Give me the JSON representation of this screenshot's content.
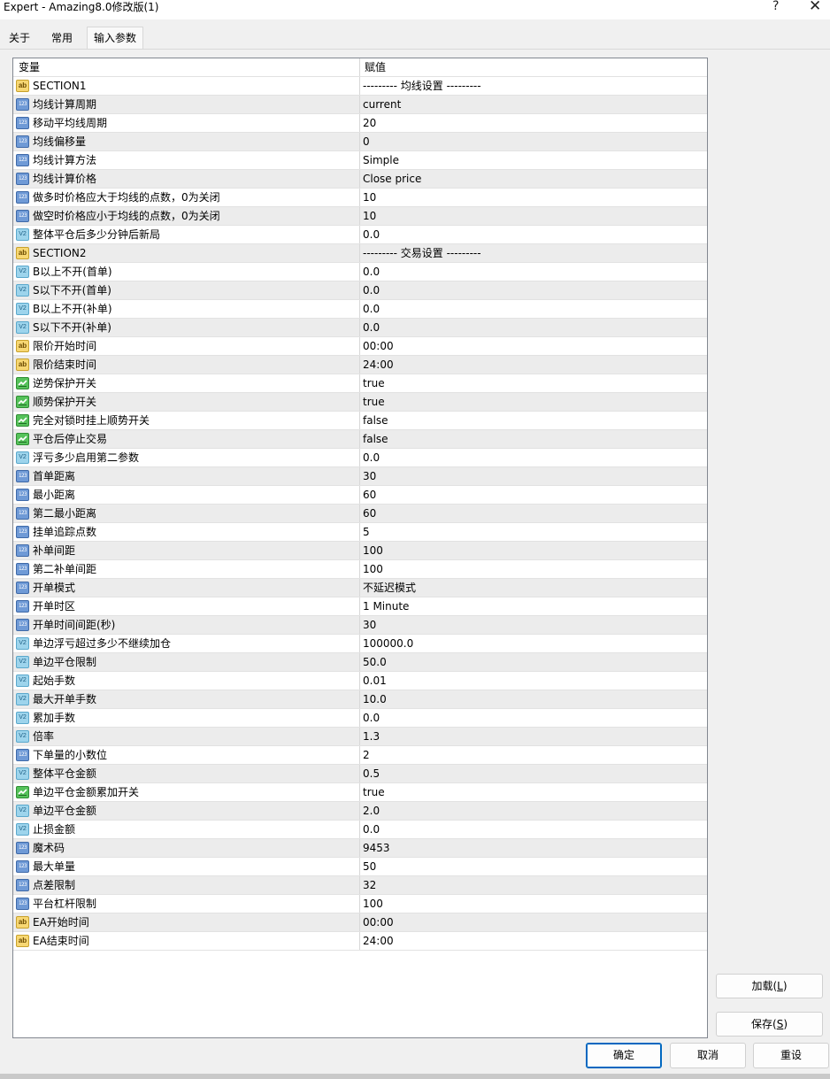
{
  "window": {
    "title": "Expert - Amazing8.0修改版(1)",
    "help_glyph": "?",
    "close_glyph": "✕"
  },
  "tabs": [
    {
      "label": "关于"
    },
    {
      "label": "常用"
    },
    {
      "label": "输入参数",
      "active": true
    }
  ],
  "grid": {
    "col_variable": "变量",
    "col_value": "赋值",
    "rows": [
      {
        "type": "string",
        "icon_text": "ab",
        "name": "SECTION1",
        "value": "--------- 均线设置 ---------"
      },
      {
        "type": "int",
        "icon_text": "123",
        "name": "均线计算周期",
        "value": "current"
      },
      {
        "type": "int",
        "icon_text": "123",
        "name": "移动平均线周期",
        "value": "20"
      },
      {
        "type": "int",
        "icon_text": "123",
        "name": "均线偏移量",
        "value": "0"
      },
      {
        "type": "int",
        "icon_text": "123",
        "name": "均线计算方法",
        "value": "Simple"
      },
      {
        "type": "int",
        "icon_text": "123",
        "name": "均线计算价格",
        "value": "Close price"
      },
      {
        "type": "int",
        "icon_text": "123",
        "name": "做多时价格应大于均线的点数，0为关闭",
        "value": "10"
      },
      {
        "type": "int",
        "icon_text": "123",
        "name": "做空时价格应小于均线的点数，0为关闭",
        "value": "10"
      },
      {
        "type": "double",
        "icon_text": "V2",
        "name": "整体平仓后多少分钟后新局",
        "value": "0.0"
      },
      {
        "type": "string",
        "icon_text": "ab",
        "name": "SECTION2",
        "value": "--------- 交易设置 ---------"
      },
      {
        "type": "double",
        "icon_text": "V2",
        "name": "B以上不开(首单)",
        "value": "0.0"
      },
      {
        "type": "double",
        "icon_text": "V2",
        "name": "S以下不开(首单)",
        "value": "0.0"
      },
      {
        "type": "double",
        "icon_text": "V2",
        "name": "B以上不开(补单)",
        "value": "0.0"
      },
      {
        "type": "double",
        "icon_text": "V2",
        "name": "S以下不开(补单)",
        "value": "0.0"
      },
      {
        "type": "string",
        "icon_text": "ab",
        "name": "限价开始时间",
        "value": "00:00"
      },
      {
        "type": "string",
        "icon_text": "ab",
        "name": "限价结束时间",
        "value": "24:00"
      },
      {
        "type": "bool",
        "icon_text": "",
        "name": "逆势保护开关",
        "value": "true"
      },
      {
        "type": "bool",
        "icon_text": "",
        "name": "顺势保护开关",
        "value": "true"
      },
      {
        "type": "bool",
        "icon_text": "",
        "name": "完全对锁时挂上顺势开关",
        "value": "false"
      },
      {
        "type": "bool",
        "icon_text": "",
        "name": "平仓后停止交易",
        "value": "false"
      },
      {
        "type": "double",
        "icon_text": "V2",
        "name": "浮亏多少启用第二参数",
        "value": "0.0"
      },
      {
        "type": "int",
        "icon_text": "123",
        "name": "首单距离",
        "value": "30"
      },
      {
        "type": "int",
        "icon_text": "123",
        "name": "最小距离",
        "value": "60"
      },
      {
        "type": "int",
        "icon_text": "123",
        "name": "第二最小距离",
        "value": "60"
      },
      {
        "type": "int",
        "icon_text": "123",
        "name": "挂单追踪点数",
        "value": "5"
      },
      {
        "type": "int",
        "icon_text": "123",
        "name": "补单间距",
        "value": "100"
      },
      {
        "type": "int",
        "icon_text": "123",
        "name": "第二补单间距",
        "value": "100"
      },
      {
        "type": "int",
        "icon_text": "123",
        "name": "开单模式",
        "value": "不延迟模式"
      },
      {
        "type": "int",
        "icon_text": "123",
        "name": "开单时区",
        "value": "1 Minute"
      },
      {
        "type": "int",
        "icon_text": "123",
        "name": "开单时间间距(秒)",
        "value": "30"
      },
      {
        "type": "double",
        "icon_text": "V2",
        "name": "单边浮亏超过多少不继续加仓",
        "value": "100000.0"
      },
      {
        "type": "double",
        "icon_text": "V2",
        "name": "单边平仓限制",
        "value": "50.0"
      },
      {
        "type": "double",
        "icon_text": "V2",
        "name": "起始手数",
        "value": "0.01"
      },
      {
        "type": "double",
        "icon_text": "V2",
        "name": "最大开单手数",
        "value": "10.0"
      },
      {
        "type": "double",
        "icon_text": "V2",
        "name": "累加手数",
        "value": "0.0"
      },
      {
        "type": "double",
        "icon_text": "V2",
        "name": "倍率",
        "value": "1.3"
      },
      {
        "type": "int",
        "icon_text": "123",
        "name": "下单量的小数位",
        "value": "2"
      },
      {
        "type": "double",
        "icon_text": "V2",
        "name": "整体平仓金额",
        "value": "0.5"
      },
      {
        "type": "bool",
        "icon_text": "",
        "name": "单边平仓金额累加开关",
        "value": "true"
      },
      {
        "type": "double",
        "icon_text": "V2",
        "name": "单边平仓金额",
        "value": "2.0"
      },
      {
        "type": "double",
        "icon_text": "V2",
        "name": "止损金额",
        "value": "0.0"
      },
      {
        "type": "int",
        "icon_text": "123",
        "name": "魔术码",
        "value": "9453"
      },
      {
        "type": "int",
        "icon_text": "123",
        "name": "最大单量",
        "value": "50"
      },
      {
        "type": "int",
        "icon_text": "123",
        "name": "点差限制",
        "value": "32"
      },
      {
        "type": "int",
        "icon_text": "123",
        "name": "平台杠杆限制",
        "value": "100"
      },
      {
        "type": "string",
        "icon_text": "ab",
        "name": "EA开始时间",
        "value": "00:00"
      },
      {
        "type": "string",
        "icon_text": "ab",
        "name": "EA结束时间",
        "value": "24:00"
      }
    ]
  },
  "side_buttons": {
    "load": {
      "label": "加载(",
      "mnemonic": "L",
      "suffix": ")"
    },
    "save": {
      "label": "保存(",
      "mnemonic": "S",
      "suffix": ")"
    }
  },
  "bottom_buttons": {
    "ok": "确定",
    "cancel": "取消",
    "reset": "重设"
  },
  "colors": {
    "row_alt": "#ececec",
    "ok_border": "#0067c0",
    "bool_icon": "#55c25a",
    "int_icon": "#6f9ad6",
    "double_icon": "#9dd4ec",
    "string_icon": "#f7d773"
  }
}
